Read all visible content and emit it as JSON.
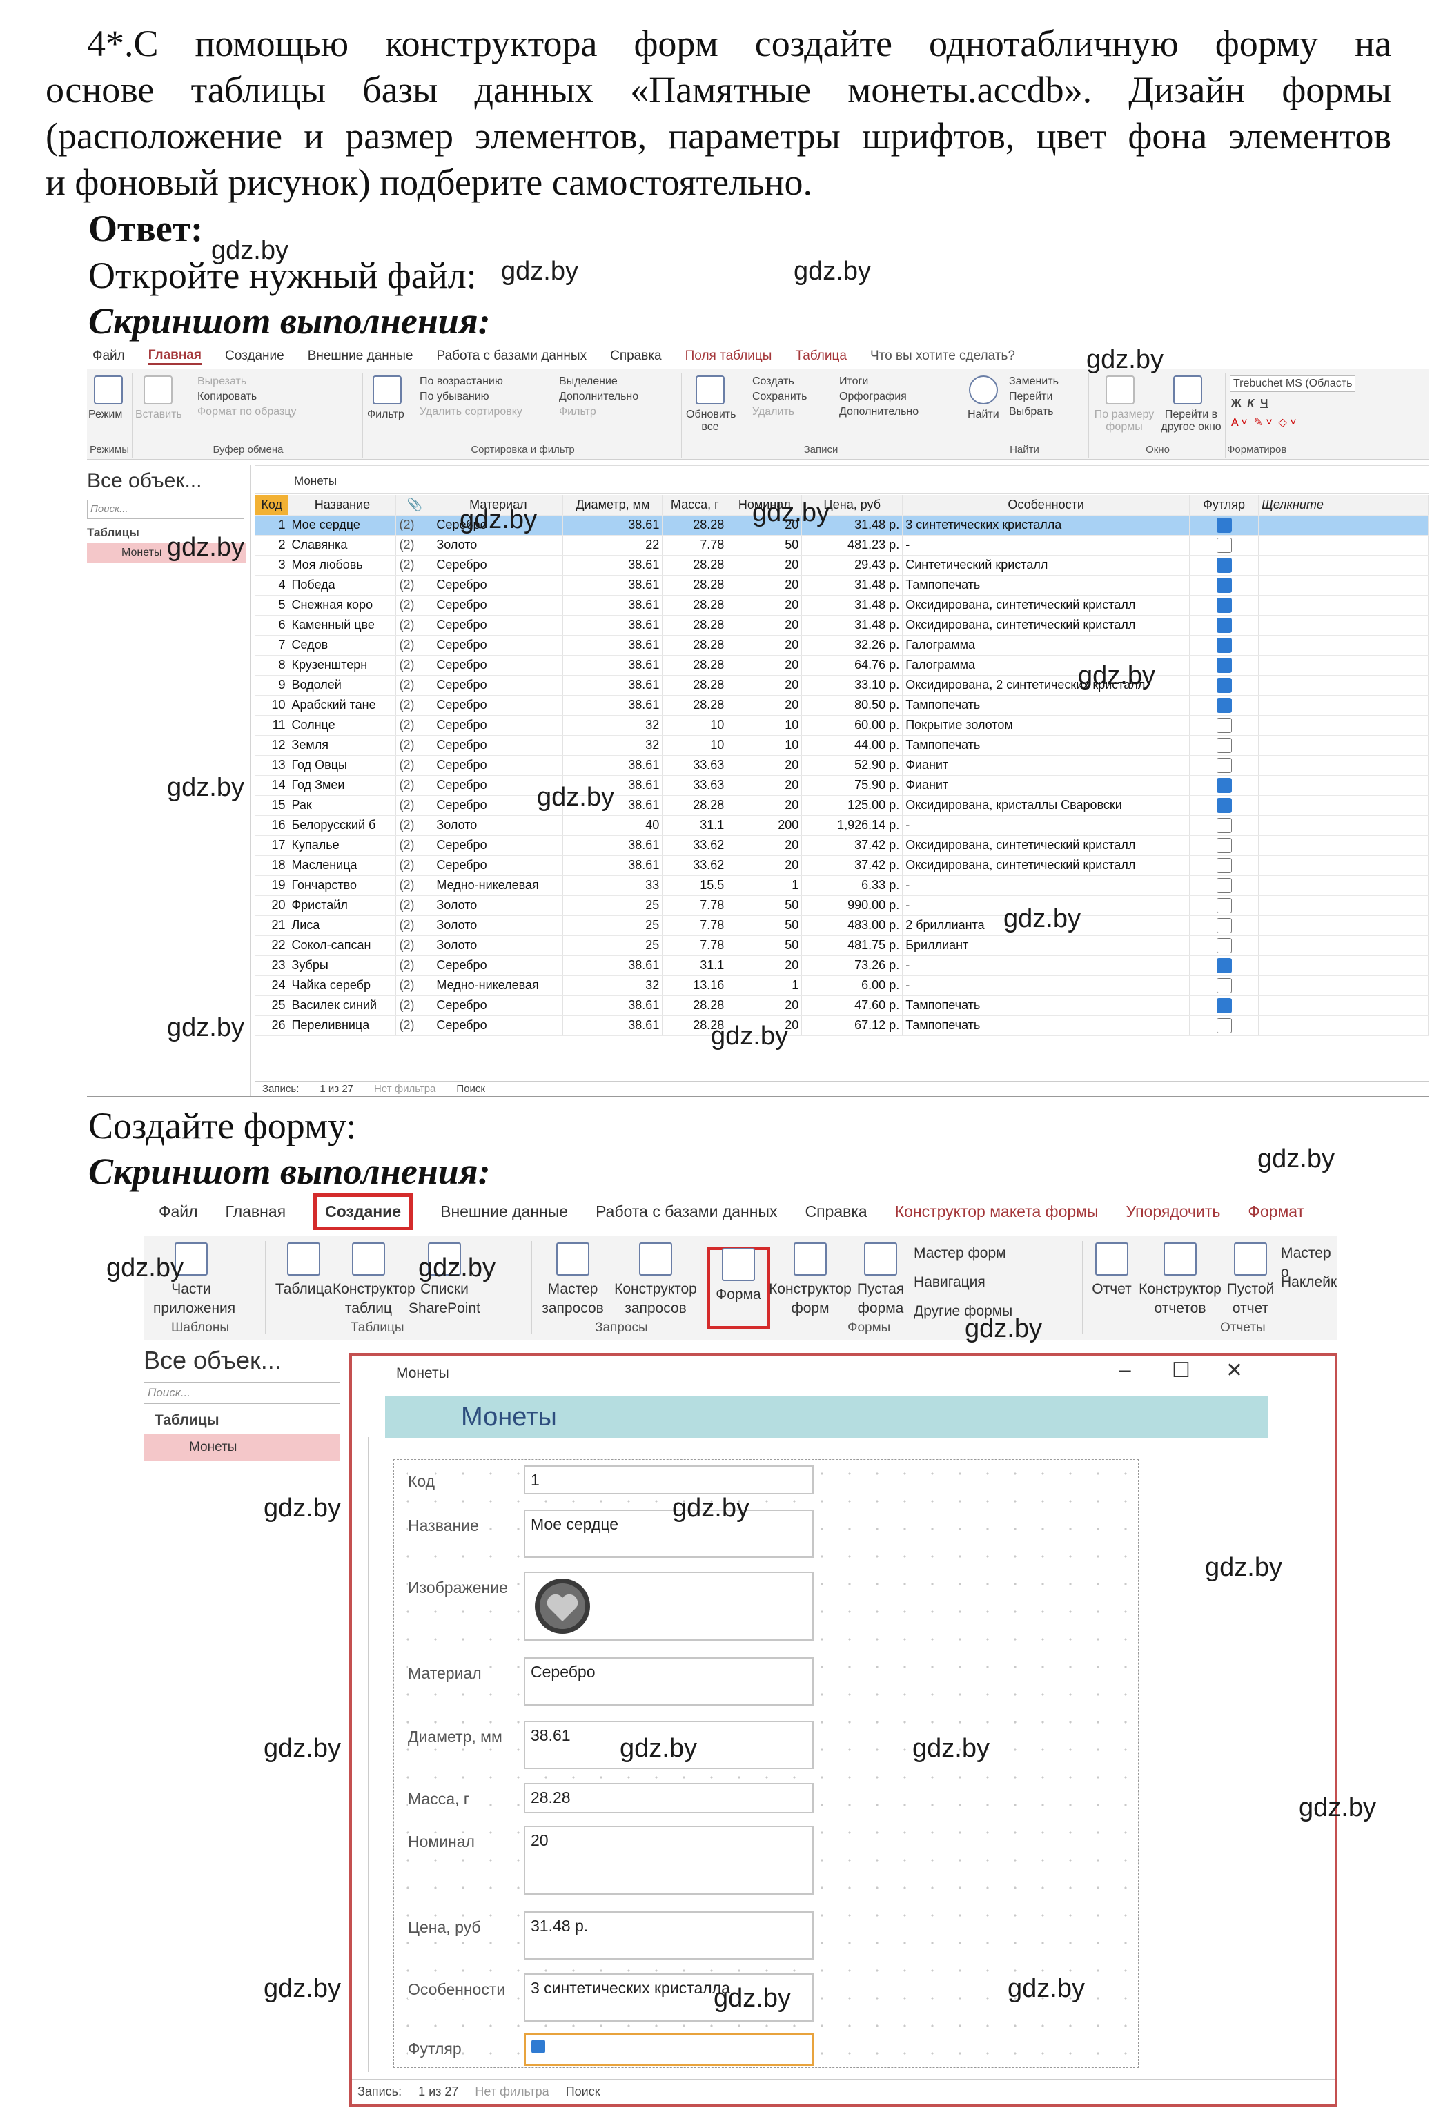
{
  "task": {
    "lines": [
      "4*.С помощью конструктора форм создайте однотабличную форму на",
      "основе таблицы базы данных «Памятные монеты.accdb». Дизайн формы",
      "(расположение и размер элементов, параметры шрифтов, цвет фона элементов",
      "и фоновый рисунок) подберите самостоятельно."
    ]
  },
  "answer_label": "Ответ:",
  "step1": "Откройте нужный файл:",
  "shot_title": "Скриншот выполнения:",
  "step2": "Создайте форму:",
  "watermark": "gdz.by",
  "screen1": {
    "menu": [
      "Файл",
      "Главная",
      "Создание",
      "Внешние данные",
      "Работа с базами данных",
      "Справка",
      "Поля таблицы",
      "Таблица",
      "Что вы хотите сделать?"
    ],
    "ribbon": {
      "mode": "Режим",
      "paste": "Вставить",
      "cut": "Вырезать",
      "copy": "Копировать",
      "format_painter": "Формат по образцу",
      "filter": "Фильтр",
      "asc": "По возрастанию",
      "desc": "По убыванию",
      "remove_sort": "Удалить сортировку",
      "selection": "Выделение",
      "advanced": "Дополнительно",
      "toggle_filter": "Фильтр",
      "refresh": "Обновить все",
      "new": "Создать",
      "save": "Сохранить",
      "delete": "Удалить",
      "totals": "Итоги",
      "spelling": "Орфография",
      "more": "Дополнительно",
      "find": "Найти",
      "replace": "Заменить",
      "goto": "Перейти",
      "select": "Выбрать",
      "size_to_fit": "По размеру формы",
      "switch_windows": "Перейти в другое окно",
      "font": "Trebuchet MS (Область",
      "groups": [
        "Режимы",
        "Буфер обмена",
        "Сортировка и фильтр",
        "Записи",
        "Найти",
        "Окно",
        "Форматиров"
      ]
    },
    "nav": {
      "title": "Все объек...",
      "search": "Поиск...",
      "section": "Таблицы",
      "item": "Монеты"
    },
    "tab": "Монеты",
    "columns": [
      "Код",
      "Название",
      "",
      "Материал",
      "Диаметр, мм",
      "Масса, г",
      "Номинал",
      "Цена, руб",
      "Особенности",
      "Футляр",
      "Щелкните"
    ],
    "rows": [
      [
        "1",
        "Мое сердце",
        "(2)",
        "Серебро",
        "38.61",
        "28.28",
        "20",
        "31.48 р.",
        "3 синтетических кристалла",
        true
      ],
      [
        "2",
        "Славянка",
        "(2)",
        "Золото",
        "22",
        "7.78",
        "50",
        "481.23 р.",
        "-",
        false
      ],
      [
        "3",
        "Моя любовь",
        "(2)",
        "Серебро",
        "38.61",
        "28.28",
        "20",
        "29.43 р.",
        "Синтетический кристалл",
        true
      ],
      [
        "4",
        "Победа",
        "(2)",
        "Серебро",
        "38.61",
        "28.28",
        "20",
        "31.48 р.",
        "Тампопечать",
        true
      ],
      [
        "5",
        "Снежная коро",
        "(2)",
        "Серебро",
        "38.61",
        "28.28",
        "20",
        "31.48 р.",
        "Оксидирована, синтетический кристалл",
        true
      ],
      [
        "6",
        "Каменный цве",
        "(2)",
        "Серебро",
        "38.61",
        "28.28",
        "20",
        "31.48 р.",
        "Оксидирована, синтетический кристалл",
        true
      ],
      [
        "7",
        "Седов",
        "(2)",
        "Серебро",
        "38.61",
        "28.28",
        "20",
        "32.26 р.",
        "Галограмма",
        true
      ],
      [
        "8",
        "Крузенштерн",
        "(2)",
        "Серебро",
        "38.61",
        "28.28",
        "20",
        "64.76 р.",
        "Галограмма",
        true
      ],
      [
        "9",
        "Водолей",
        "(2)",
        "Серебро",
        "38.61",
        "28.28",
        "20",
        "33.10 р.",
        "Оксидирована, 2 синтетических кристалл",
        true
      ],
      [
        "10",
        "Арабский тане",
        "(2)",
        "Серебро",
        "38.61",
        "28.28",
        "20",
        "80.50 р.",
        "Тампопечать",
        true
      ],
      [
        "11",
        "Солнце",
        "(2)",
        "Серебро",
        "32",
        "10",
        "10",
        "60.00 р.",
        "Покрытие золотом",
        false
      ],
      [
        "12",
        "Земля",
        "(2)",
        "Серебро",
        "32",
        "10",
        "10",
        "44.00 р.",
        "Тампопечать",
        false
      ],
      [
        "13",
        "Год Овцы",
        "(2)",
        "Серебро",
        "38.61",
        "33.63",
        "20",
        "52.90 р.",
        "Фианит",
        false
      ],
      [
        "14",
        "Год Змеи",
        "(2)",
        "Серебро",
        "38.61",
        "33.63",
        "20",
        "75.90 р.",
        "Фианит",
        true
      ],
      [
        "15",
        "Рак",
        "(2)",
        "Серебро",
        "38.61",
        "28.28",
        "20",
        "125.00 р.",
        "Оксидирована, кристаллы Сваровски",
        true
      ],
      [
        "16",
        "Белорусский б",
        "(2)",
        "Золото",
        "40",
        "31.1",
        "200",
        "1,926.14 р.",
        "-",
        false
      ],
      [
        "17",
        "Купалье",
        "(2)",
        "Серебро",
        "38.61",
        "33.62",
        "20",
        "37.42 р.",
        "Оксидирована, синтетический кристалл",
        false
      ],
      [
        "18",
        "Масленица",
        "(2)",
        "Серебро",
        "38.61",
        "33.62",
        "20",
        "37.42 р.",
        "Оксидирована, синтетический кристалл",
        false
      ],
      [
        "19",
        "Гончарство",
        "(2)",
        "Медно-никелевая",
        "33",
        "15.5",
        "1",
        "6.33 р.",
        "-",
        false
      ],
      [
        "20",
        "Фристайл",
        "(2)",
        "Золото",
        "25",
        "7.78",
        "50",
        "990.00 р.",
        "-",
        false
      ],
      [
        "21",
        "Лиса",
        "(2)",
        "Золото",
        "25",
        "7.78",
        "50",
        "483.00 р.",
        "2 бриллианта",
        false
      ],
      [
        "22",
        "Сокол-сапсан",
        "(2)",
        "Золото",
        "25",
        "7.78",
        "50",
        "481.75 р.",
        "Бриллиант",
        false
      ],
      [
        "23",
        "Зубры",
        "(2)",
        "Серебро",
        "38.61",
        "31.1",
        "20",
        "73.26 р.",
        "-",
        true
      ],
      [
        "24",
        "Чайка серебр",
        "(2)",
        "Медно-никелевая",
        "32",
        "13.16",
        "1",
        "6.00 р.",
        "-",
        false
      ],
      [
        "25",
        "Василек синий",
        "(2)",
        "Серебро",
        "38.61",
        "28.28",
        "20",
        "47.60 р.",
        "Тампопечать",
        true
      ],
      [
        "26",
        "Переливница",
        "(2)",
        "Серебро",
        "38.61",
        "28.28",
        "20",
        "67.12 р.",
        "Тампопечать",
        false
      ]
    ],
    "status": {
      "record": "Запись:",
      "pos": "1 из 27",
      "filter": "Нет фильтра",
      "search": "Поиск"
    }
  },
  "screen2": {
    "menu": [
      "Файл",
      "Главная",
      "Создание",
      "Внешние данные",
      "Работа с базами данных",
      "Справка",
      "Конструктор макета формы",
      "Упорядочить",
      "Формат"
    ],
    "ribbon": {
      "parts": "Части приложения",
      "table": "Таблица",
      "table_designer": "Конструктор таблиц",
      "sp_lists": "Списки SharePoint",
      "query_wizard": "Мастер запросов",
      "query_designer": "Конструктор запросов",
      "form": "Форма",
      "form_designer": "Конструктор форм",
      "blank_form": "Пустая форма",
      "form_wizard": "Мастер форм",
      "navigation": "Навигация",
      "other_forms": "Другие формы",
      "report": "Отчет",
      "report_designer": "Конструктор отчетов",
      "blank_report": "Пустой отчет",
      "report_wizard": "Мастер о",
      "labels": "Наклейк",
      "groups": [
        "Шаблоны",
        "Таблицы",
        "Запросы",
        "Формы",
        "Отчеты"
      ]
    },
    "nav": {
      "title": "Все объек...",
      "search": "Поиск...",
      "section": "Таблицы",
      "item": "Монеты"
    },
    "window_title": "Монеты",
    "form_header": "Монеты",
    "fields": [
      {
        "label": "Код",
        "value": "1"
      },
      {
        "label": "Название",
        "value": "Мое сердце"
      },
      {
        "label": "Изображение",
        "value": ""
      },
      {
        "label": "Материал",
        "value": "Серебро"
      },
      {
        "label": "Диаметр, мм",
        "value": "38.61"
      },
      {
        "label": "Масса, г",
        "value": "28.28"
      },
      {
        "label": "Номинал",
        "value": "20"
      },
      {
        "label": "Цена, руб",
        "value": "31.48 р."
      },
      {
        "label": "Особенности",
        "value": "3 синтетических кристалла"
      },
      {
        "label": "Футляр",
        "value": ""
      }
    ],
    "status": {
      "record": "Запись:",
      "pos": "1 из 27",
      "filter": "Нет фильтра",
      "search": "Поиск"
    }
  }
}
